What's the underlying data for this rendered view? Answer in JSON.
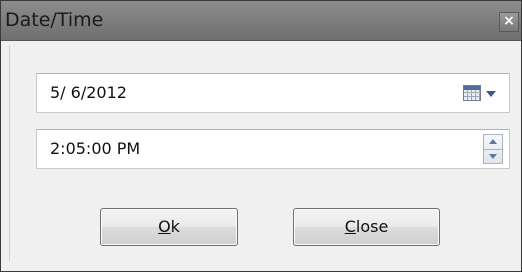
{
  "window": {
    "title": "Date/Time",
    "close_glyph": "×"
  },
  "date_picker": {
    "value": "5/ 6/2012",
    "icon": "calendar-icon"
  },
  "time_picker": {
    "value": "2:05:00 PM",
    "icon": "spin-updown-icon"
  },
  "buttons": {
    "ok": {
      "accel": "O",
      "rest": "k"
    },
    "close": {
      "accel": "C",
      "rest": "lose"
    }
  },
  "colors": {
    "titlebar": "#7f7f7f",
    "dialog_bg": "#f0f0f0",
    "field_bg": "#ffffff"
  }
}
